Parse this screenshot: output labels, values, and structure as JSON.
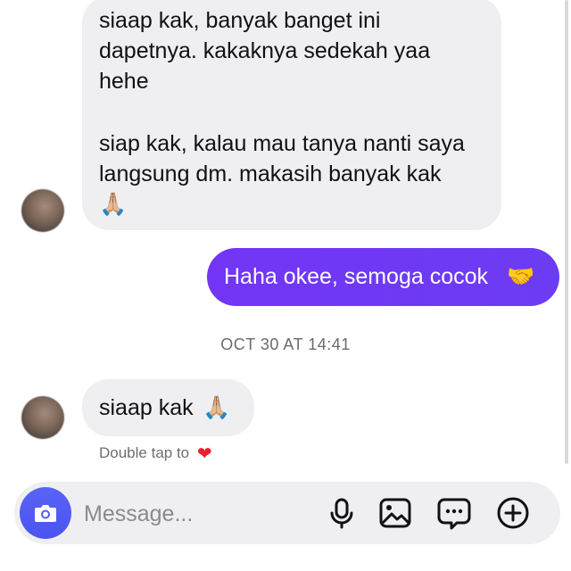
{
  "messages": {
    "incoming_1": {
      "lines_a": [
        "siaap kak, banyak banget ini",
        "dapetnya. kakaknya sedekah yaa",
        "hehe"
      ],
      "lines_b": [
        "siap kak, kalau mau tanya nanti saya",
        "langsung dm. makasih banyak kak"
      ],
      "emoji": "🙏🏼"
    },
    "outgoing_1": {
      "text": "Haha okee, semoga cocok",
      "emoji": "🤝"
    },
    "timestamp": "OCT 30 AT 14:41",
    "incoming_2": {
      "text": "siaap kak",
      "emoji": "🙏🏼"
    },
    "double_tap_hint": "Double tap to",
    "heart": "❤"
  },
  "composer": {
    "placeholder": "Message..."
  },
  "colors": {
    "outgoing_bubble": "#6f38f5",
    "incoming_bubble": "#efeff2",
    "camera_button": "#4f5ff5",
    "heart": "#e8222f"
  },
  "icons": [
    "camera-icon",
    "microphone-icon",
    "image-icon",
    "message-dots-icon",
    "plus-circle-icon",
    "heart-icon",
    "praying-hands-icon",
    "handshake-icon"
  ]
}
